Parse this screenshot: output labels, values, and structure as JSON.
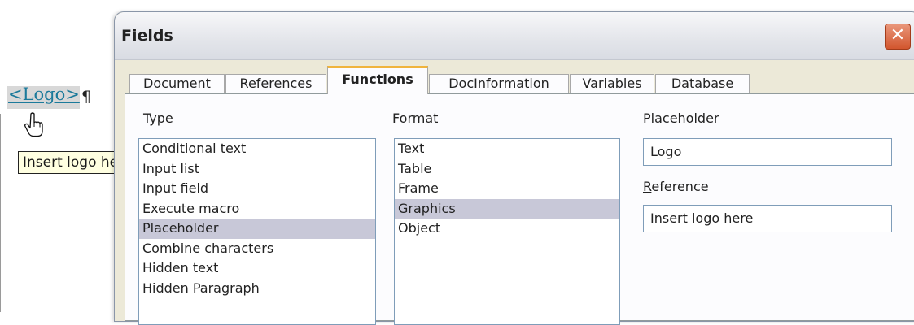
{
  "document": {
    "field_text": "<Logo>",
    "pilcrow": "¶",
    "tooltip": "Insert logo here"
  },
  "dialog": {
    "title": "Fields",
    "close_glyph": "✕",
    "tabs": [
      {
        "label": "Document"
      },
      {
        "label": "References"
      },
      {
        "label": "Functions",
        "active": true
      },
      {
        "label": "DocInformation"
      },
      {
        "label": "Variables"
      },
      {
        "label": "Database"
      }
    ],
    "type": {
      "label_prefix": "",
      "label_mnemonic": "T",
      "label_rest": "ype",
      "items": [
        "Conditional text",
        "Input list",
        "Input field",
        "Execute macro",
        "Placeholder",
        "Combine characters",
        "Hidden text",
        "Hidden Paragraph"
      ],
      "selected_index": 4
    },
    "format": {
      "label_prefix": "F",
      "label_mnemonic": "o",
      "label_rest": "rmat",
      "items": [
        "Text",
        "Table",
        "Frame",
        "Graphics",
        "Object"
      ],
      "selected_index": 3
    },
    "placeholder": {
      "label": "Placeholder",
      "value": "Logo"
    },
    "reference": {
      "label_mnemonic": "R",
      "label_rest": "eference",
      "value": "Insert logo here"
    }
  },
  "colors": {
    "field_link": "#1b7a9b",
    "tooltip_bg": "#ffffe1",
    "selection": "#c8c8d8",
    "active_tab_accent": "#f0b43c"
  }
}
